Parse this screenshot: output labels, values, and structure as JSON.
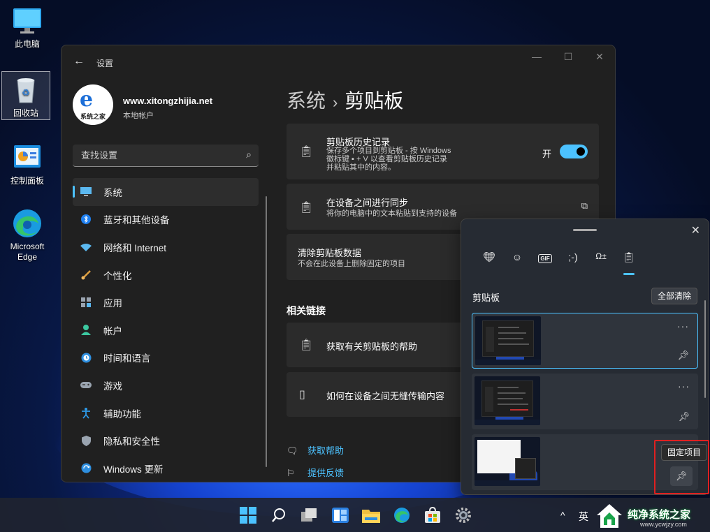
{
  "desktop": {
    "icons": [
      {
        "label": "此电脑"
      },
      {
        "label": "回收站"
      },
      {
        "label": "控制面板"
      },
      {
        "label": "Microsoft Edge"
      }
    ]
  },
  "settings": {
    "window_title": "设置",
    "profile": {
      "name": "www.xitongzhijia.net",
      "account": "本地帐户",
      "avatar_text": "系统之家"
    },
    "search": {
      "placeholder": "查找设置"
    },
    "nav": [
      {
        "label": "系统",
        "icon": "monitor-icon",
        "active": true
      },
      {
        "label": "蓝牙和其他设备",
        "icon": "bluetooth-icon"
      },
      {
        "label": "网络和 Internet",
        "icon": "wifi-icon"
      },
      {
        "label": "个性化",
        "icon": "brush-icon"
      },
      {
        "label": "应用",
        "icon": "apps-icon"
      },
      {
        "label": "帐户",
        "icon": "person-icon"
      },
      {
        "label": "时间和语言",
        "icon": "clock-globe-icon"
      },
      {
        "label": "游戏",
        "icon": "gamepad-icon"
      },
      {
        "label": "辅助功能",
        "icon": "accessibility-icon"
      },
      {
        "label": "隐私和安全性",
        "icon": "shield-icon"
      },
      {
        "label": "Windows 更新",
        "icon": "update-icon"
      }
    ],
    "breadcrumb": {
      "parent": "系统",
      "separator": "›",
      "current": "剪贴板"
    },
    "cards": {
      "history": {
        "title": "剪贴板历史记录",
        "desc_line1": "保存多个项目到剪贴板 - 按 Windows",
        "desc_line2": "徽标键 ▪ + V 以查看剪贴板历史记录",
        "desc_line3": "并粘贴其中的内容。",
        "toggle_label": "开",
        "toggle_on": true
      },
      "sync": {
        "title": "在设备之间进行同步",
        "desc": "将你的电脑中的文本粘贴到支持的设备"
      },
      "clear": {
        "title": "清除剪贴板数据",
        "desc": "不会在此设备上删除固定的项目"
      }
    },
    "related": {
      "heading": "相关链接",
      "items": [
        {
          "label": "获取有关剪贴板的帮助"
        },
        {
          "label": "如何在设备之间无缝传输内容"
        }
      ]
    },
    "footer_links": [
      {
        "label": "获取帮助"
      },
      {
        "label": "提供反馈"
      }
    ]
  },
  "clipboard_panel": {
    "tabs": [
      {
        "icon": "sticker-heart-icon"
      },
      {
        "icon": "emoji-icon"
      },
      {
        "icon": "gif-icon",
        "text": "GIF"
      },
      {
        "icon": "kaomoji-icon",
        "text": ";-)"
      },
      {
        "icon": "symbols-icon"
      },
      {
        "icon": "clipboard-icon",
        "active": true
      }
    ],
    "heading": "剪贴板",
    "clear_all": "全部清除",
    "items": [
      {
        "selected": true
      },
      {
        "selected": false
      },
      {
        "selected": false
      }
    ],
    "more_glyph": "···",
    "tooltip": "固定项目"
  },
  "taskbar": {
    "icons": [
      "start-icon",
      "search-icon",
      "task-view-icon",
      "widgets-icon",
      "file-explorer-icon",
      "edge-icon",
      "store-icon",
      "settings-icon"
    ],
    "tray": {
      "chevron": "^",
      "ime": "英"
    }
  },
  "watermark": {
    "text": "纯净系统之家",
    "url": "www.ycwjzy.com"
  },
  "colors": {
    "accent": "#4cc2ff",
    "window_bg": "#202020",
    "card_bg": "#2b2b2b",
    "highlight": "#e02020"
  }
}
